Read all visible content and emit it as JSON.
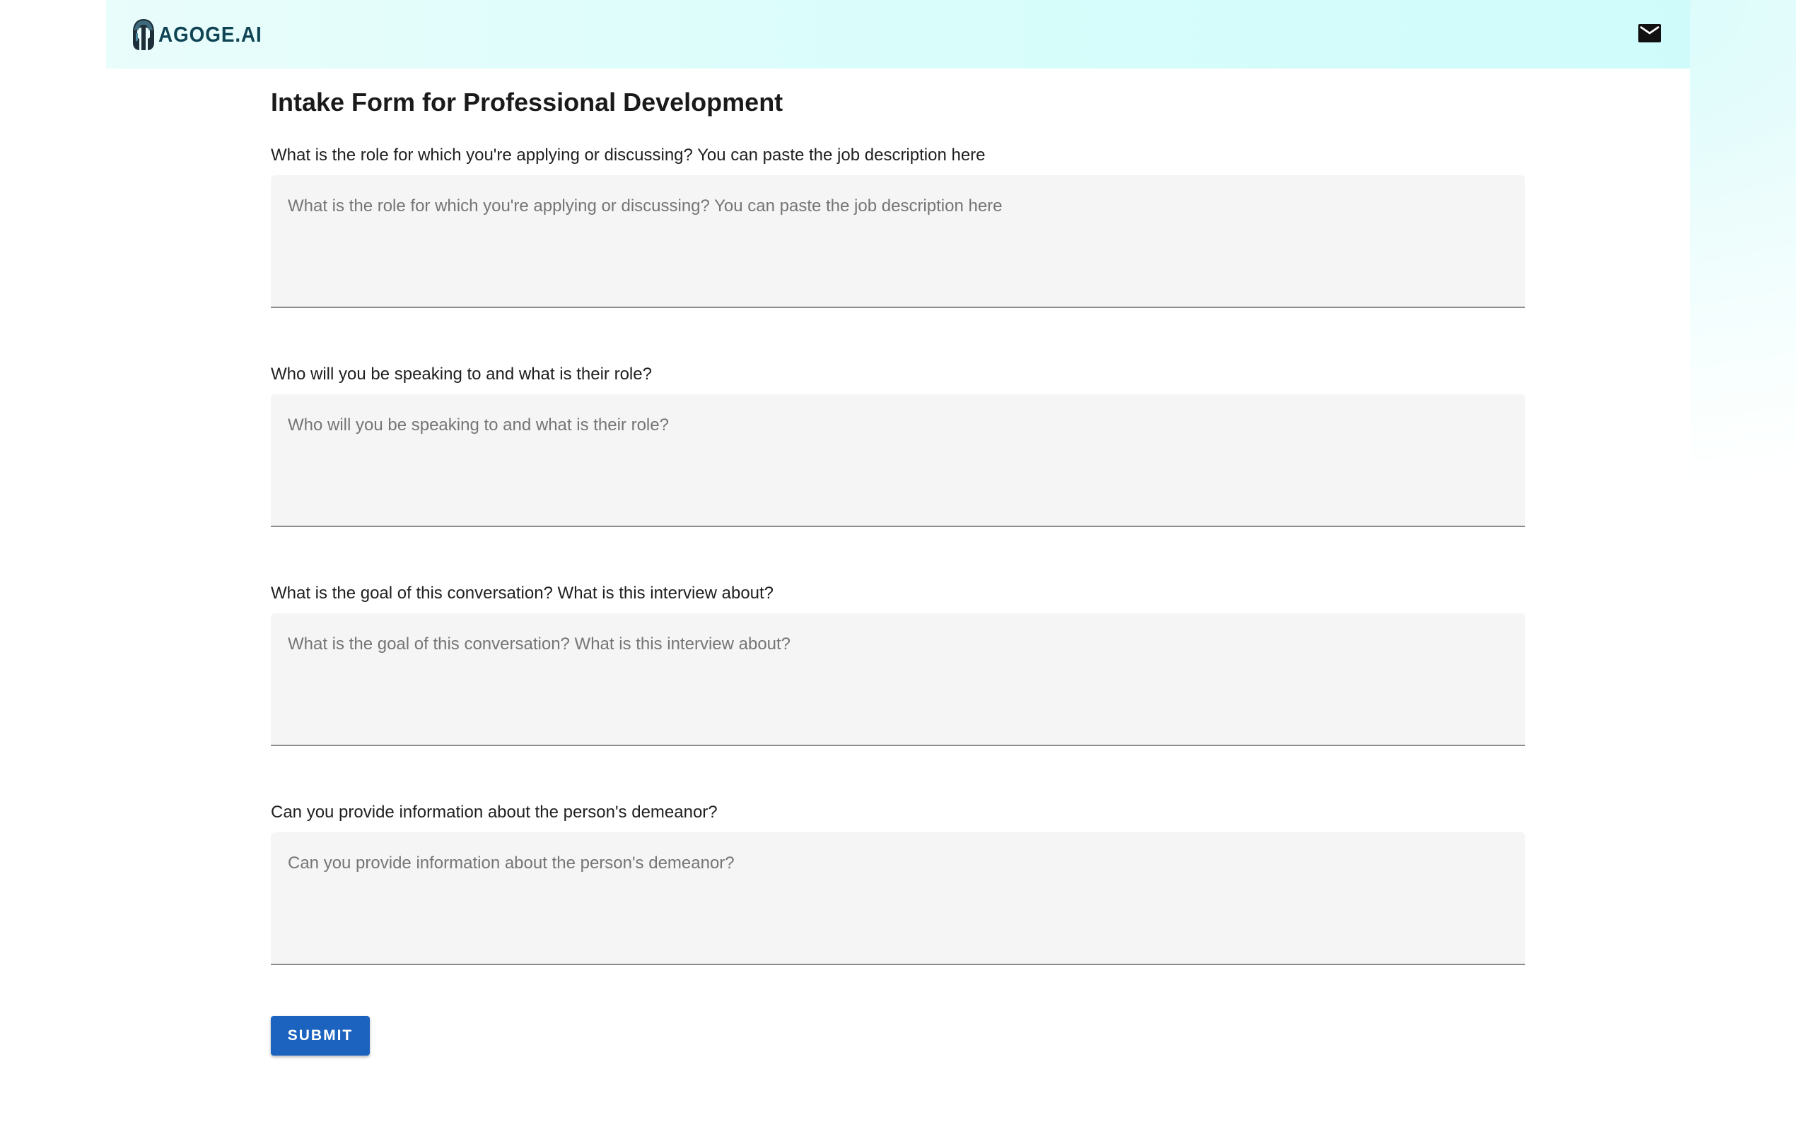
{
  "header": {
    "brand_text": "AGOGE.AI",
    "logo_icon": "helmet-icon",
    "mail_icon": "mail-icon"
  },
  "form": {
    "title": "Intake Form for Professional Development",
    "fields": [
      {
        "label": "What is the role for which you're applying or discussing? You can paste the job description here",
        "placeholder": "What is the role for which you're applying or discussing? You can paste the job description here",
        "value": ""
      },
      {
        "label": "Who will you be speaking to and what is their role?",
        "placeholder": "Who will you be speaking to and what is their role?",
        "value": ""
      },
      {
        "label": "What is the goal of this conversation? What is this interview about?",
        "placeholder": "What is the goal of this conversation? What is this interview about?",
        "value": ""
      },
      {
        "label": "Can you provide information about the person's demeanor?",
        "placeholder": "Can you provide information about the person's demeanor?",
        "value": ""
      }
    ],
    "submit_label": "SUBMIT"
  },
  "colors": {
    "accent": "#1c63c0",
    "brand_text": "#0f4454",
    "header_bg": "#d9fdfb",
    "field_bg": "#f5f5f5"
  }
}
